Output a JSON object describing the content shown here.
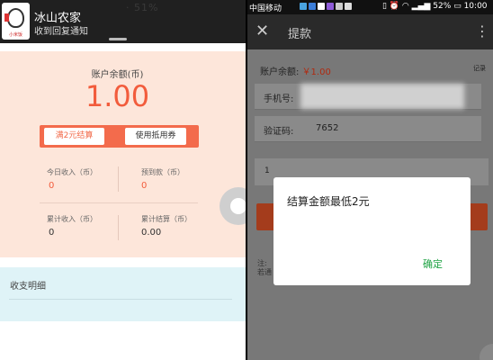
{
  "left": {
    "notification": {
      "app_name": "冰山农家",
      "message": "收到回复通知",
      "icon_text": "小米饭",
      "faint_text": "· 51%"
    },
    "balance_label": "账户余额(币)",
    "balance_amount": "1.00",
    "settle_button": "满2元结算",
    "coupon_button": "使用抵用券",
    "stats": {
      "today_income_label": "今日收入（币）",
      "today_income_value": "0",
      "expected_label": "预到款（币）",
      "expected_value": "0",
      "total_income_label": "累计收入（币）",
      "total_income_value": "0",
      "total_settled_label": "累计结算（币）",
      "total_settled_value": "0.00"
    },
    "ledger_title": "收支明细"
  },
  "right": {
    "status": {
      "carrier": "中国移动",
      "battery": "52%",
      "time": "10:00"
    },
    "appbar": {
      "close_glyph": "✕",
      "title": "提款",
      "more_glyph": "⋮"
    },
    "balance_label": "账户余额: ",
    "balance_amount": "￥1.00",
    "records_link": "记录",
    "phone_label": "手机号:",
    "code_label": "验证码:",
    "code_value": "7652",
    "amount_input_value": "1",
    "note_text": "注:\n若通",
    "dialog": {
      "message": "结算金额最低2元",
      "confirm": "确定"
    }
  },
  "colors": {
    "accent_orange": "#f25c3c",
    "peach_bg": "#fde6da",
    "ledger_bg": "#dff3f7",
    "confirm_green": "#1fa344"
  }
}
